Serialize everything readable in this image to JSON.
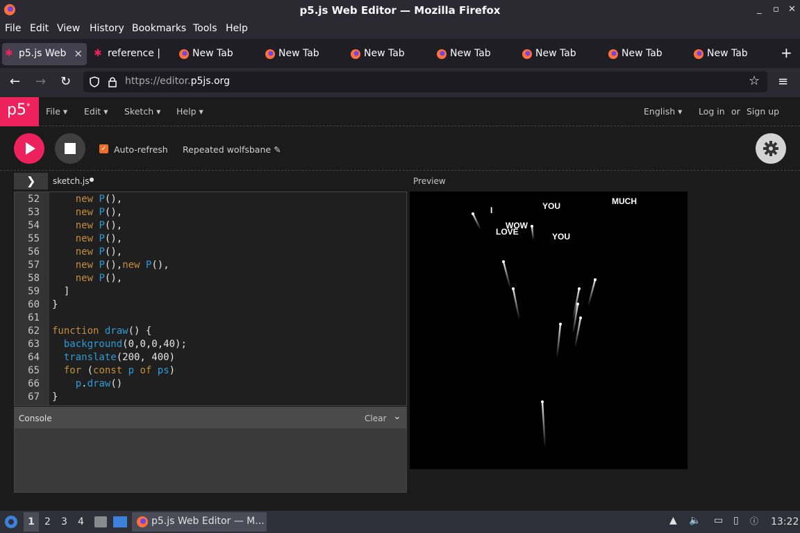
{
  "window": {
    "title": "p5.js Web Editor — Mozilla Firefox"
  },
  "menubar": [
    "File",
    "Edit",
    "View",
    "History",
    "Bookmarks",
    "Tools",
    "Help"
  ],
  "tabs": [
    {
      "label": "p5.js Web",
      "active": true
    },
    {
      "label": "reference |",
      "active": false
    },
    {
      "label": "New Tab",
      "active": false
    },
    {
      "label": "New Tab",
      "active": false
    },
    {
      "label": "New Tab",
      "active": false
    },
    {
      "label": "New Tab",
      "active": false
    },
    {
      "label": "New Tab",
      "active": false
    },
    {
      "label": "New Tab",
      "active": false
    },
    {
      "label": "New Tab",
      "active": false
    }
  ],
  "nav": {
    "url_prefix": "https://editor.",
    "url_domain": "p5js.org"
  },
  "p5": {
    "logo": "p5",
    "menus": [
      "File",
      "Edit",
      "Sketch",
      "Help"
    ],
    "language": "English",
    "login": "Log in",
    "or": "or",
    "signup": "Sign up"
  },
  "toolbar": {
    "autorefresh_label": "Auto-refresh",
    "autorefresh_checked": true,
    "sketch_name": "Repeated wolfsbane"
  },
  "editor": {
    "file_tab": "sketch.js",
    "preview_label": "Preview",
    "lines": [
      {
        "n": "52",
        "code": "    new P(),"
      },
      {
        "n": "53",
        "code": "    new P(),"
      },
      {
        "n": "54",
        "code": "    new P(),"
      },
      {
        "n": "55",
        "code": "    new P(),"
      },
      {
        "n": "56",
        "code": "    new P(),"
      },
      {
        "n": "57",
        "code": "    new P(),new P(),"
      },
      {
        "n": "58",
        "code": "    new P(),"
      },
      {
        "n": "59",
        "code": "  ]"
      },
      {
        "n": "60",
        "code": "}"
      },
      {
        "n": "61",
        "code": ""
      },
      {
        "n": "62",
        "code": "function draw() {"
      },
      {
        "n": "63",
        "code": "  background(0,0,0,40);"
      },
      {
        "n": "64",
        "code": "  translate(200, 400)"
      },
      {
        "n": "65",
        "code": "  for (const p of ps)"
      },
      {
        "n": "66",
        "code": "    p.draw()"
      },
      {
        "n": "67",
        "code": "}"
      }
    ]
  },
  "console": {
    "title": "Console",
    "clear": "Clear"
  },
  "preview_words": [
    "I",
    "YOU",
    "MUCH",
    "WOW",
    "LOVE",
    "YOU"
  ],
  "taskbar": {
    "workspaces": [
      "1",
      "2",
      "3",
      "4"
    ],
    "app_label": "p5.js Web Editor — M...",
    "clock": "13:22"
  },
  "colors": {
    "p5_pink": "#ed225d",
    "keyword": "#c48d3e",
    "function": "#2e9bd6"
  }
}
